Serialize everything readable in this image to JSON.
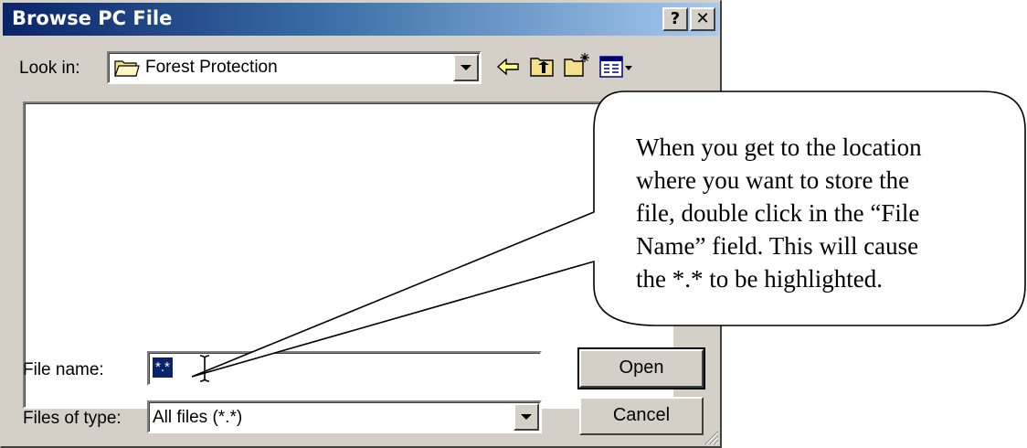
{
  "window": {
    "title": "Browse PC File",
    "help_glyph": "?",
    "close_glyph": "✕"
  },
  "look_in": {
    "label": "Look in:",
    "value": "Forest Protection",
    "folder_icon": "folder-icon"
  },
  "toolbar": {
    "icons": [
      "back-arrow-icon",
      "up-folder-icon",
      "new-folder-icon",
      "view-menu-icon"
    ]
  },
  "file_name": {
    "label": "File name:",
    "value": "*.*"
  },
  "files_of_type": {
    "label": "Files of type:",
    "value": "All files (*.*)"
  },
  "buttons": {
    "open": "Open",
    "cancel": "Cancel"
  },
  "callout": {
    "lines": [
      "When you get to the location",
      "where you want to store the",
      "file, double click in the “File",
      "Name” field.  This will cause",
      "the *.* to be highlighted."
    ]
  },
  "colors": {
    "title_start": "#0a246a",
    "title_end": "#a6caf0",
    "face": "#d4d0c8",
    "selection": "#0a246a"
  }
}
